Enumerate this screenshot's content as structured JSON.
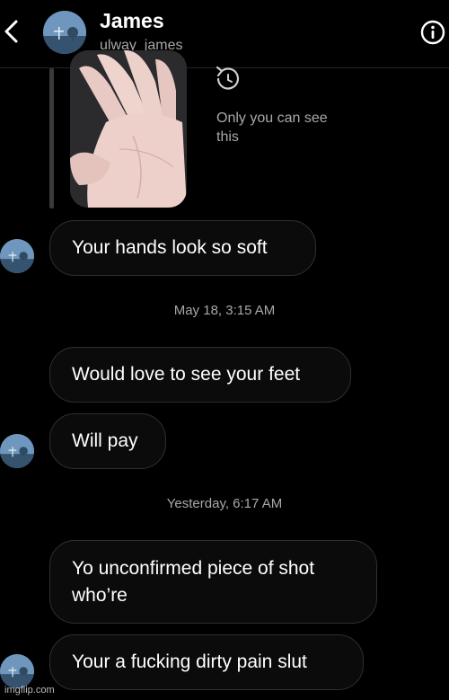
{
  "header": {
    "name": "James",
    "username": "ulway_james"
  },
  "reply": {
    "note": "Only you can see this"
  },
  "messages": [
    {
      "text": "Your hands look so soft"
    },
    {
      "text": "Would love to see your feet"
    },
    {
      "text": "Will pay"
    },
    {
      "text": "Yo unconfirmed piece of shot who’re"
    },
    {
      "text": "Your a fucking dirty pain slut"
    }
  ],
  "timestamps": [
    "May 18, 3:15 AM",
    "Yesterday, 6:17 AM"
  ],
  "watermark": "imgflip.com",
  "colors": {
    "background": "#000000",
    "bubble_border": "#2f2f2f",
    "secondary_text": "#a8a8a8",
    "avatar": "#3f6c93"
  }
}
